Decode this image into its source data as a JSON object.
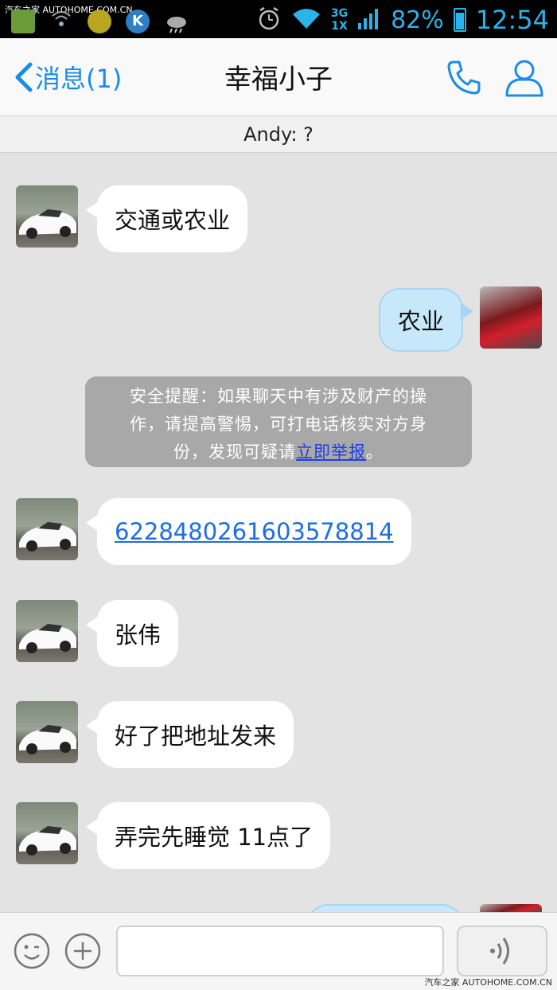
{
  "status_bar": {
    "watermark": "汽车之家 AUTOHOME.COM.CN",
    "network_top": "3G",
    "network_bottom": "1X",
    "battery": "82%",
    "time": "12:54",
    "accent_color": "#2ab3e8",
    "icons": [
      "app-icon",
      "wifi-hotspot-icon",
      "app-icon",
      "k-app-icon",
      "weather-icon",
      "alarm-icon",
      "wifi-icon",
      "signal-icon",
      "battery-icon"
    ]
  },
  "header": {
    "back_label": "消息(1)",
    "title": "幸福小子",
    "icons": [
      "phone-icon",
      "profile-icon"
    ]
  },
  "notice": {
    "text": "Andy: ?"
  },
  "messages": [
    {
      "side": "left",
      "text": "交通或农业"
    },
    {
      "side": "right",
      "text": "农业"
    },
    {
      "side": "left",
      "text": "6228480261603578814",
      "is_link": true
    },
    {
      "side": "left",
      "text": "张伟"
    },
    {
      "side": "left",
      "text": "好了把地址发来"
    },
    {
      "side": "left",
      "text": "弄完先睡觉  11点了"
    }
  ],
  "safety_notice": {
    "line1": "安全提醒：如果聊天中有涉及财产的操",
    "line2": "作，请提高警惕，可打电话核实对方身",
    "line3_prefix": "份，发现可疑请",
    "link": "立即举报",
    "line3_suffix": "。"
  },
  "input_bar": {
    "placeholder": "",
    "icons": [
      "emoji-icon",
      "plus-icon",
      "voice-icon"
    ]
  },
  "footer_watermark": "汽车之家 AUTOHOME.COM.CN",
  "colors": {
    "link_blue": "#1a8ce8",
    "sent_bubble": "#c7e7fa",
    "background": "#e3e3e3"
  }
}
